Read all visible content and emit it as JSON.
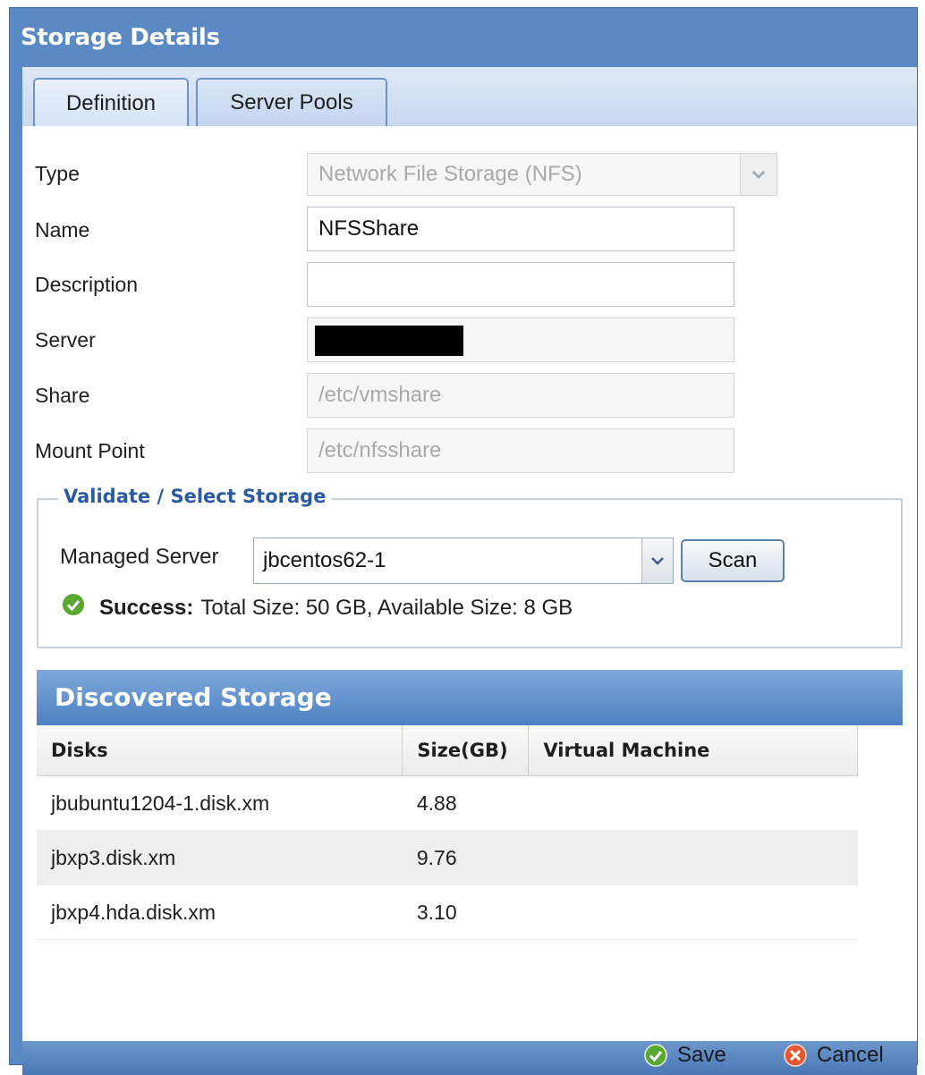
{
  "dialog": {
    "title": "Storage Details"
  },
  "tabs": [
    {
      "label": "Definition",
      "active": true
    },
    {
      "label": "Server Pools",
      "active": false
    }
  ],
  "form": {
    "type_label": "Type",
    "type_value": "Network File Storage (NFS)",
    "name_label": "Name",
    "name_value": "NFSShare",
    "description_label": "Description",
    "description_value": "",
    "server_label": "Server",
    "share_label": "Share",
    "share_value": "/etc/vmshare",
    "mount_label": "Mount Point",
    "mount_value": "/etc/nfsshare"
  },
  "validate": {
    "legend": "Validate / Select Storage",
    "managed_server_label": "Managed Server",
    "managed_server_value": "jbcentos62-1",
    "scan_label": "Scan",
    "status_bold": "Success:",
    "status_text": "Total Size: 50 GB, Available Size: 8 GB"
  },
  "discovered": {
    "title": "Discovered Storage",
    "columns": [
      "Disks",
      "Size(GB)",
      "Virtual Machine"
    ],
    "rows": [
      {
        "disk": "jbubuntu1204-1.disk.xm",
        "size": "4.88",
        "vm": ""
      },
      {
        "disk": "jbxp3.disk.xm",
        "size": "9.76",
        "vm": ""
      },
      {
        "disk": "jbxp4.hda.disk.xm",
        "size": "3.10",
        "vm": ""
      }
    ]
  },
  "footer": {
    "save_label": "Save",
    "cancel_label": "Cancel"
  },
  "colors": {
    "accent": "#5b89c4",
    "success": "#5aa832",
    "cancel": "#e4572e"
  }
}
